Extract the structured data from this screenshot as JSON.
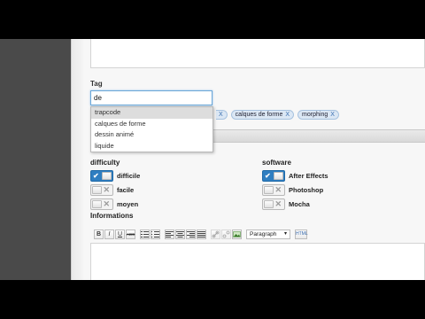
{
  "tag": {
    "label": "Tag",
    "input_value": "de",
    "suggestions": [
      "trapcode",
      "calques de forme",
      "dessin animé",
      "liquide"
    ],
    "chips": [
      {
        "label": "",
        "remove": "X"
      },
      {
        "label": "calques de forme",
        "remove": "X"
      },
      {
        "label": "morphing",
        "remove": "X"
      }
    ]
  },
  "difficulty": {
    "label": "difficulty",
    "options": [
      {
        "label": "difficile",
        "checked": true
      },
      {
        "label": "facile",
        "checked": false
      },
      {
        "label": "moyen",
        "checked": false
      }
    ]
  },
  "software": {
    "label": "software",
    "options": [
      {
        "label": "After Effects",
        "checked": true
      },
      {
        "label": "Photoshop",
        "checked": false
      },
      {
        "label": "Mocha",
        "checked": false
      }
    ]
  },
  "informations": {
    "label": "Informations",
    "toolbar": {
      "bold": "B",
      "italic": "I",
      "underline": "U",
      "strike": "ABC",
      "format_value": "Paragraph",
      "html": "HTML"
    }
  },
  "icons": {
    "check": "✔",
    "off": "✕",
    "dropdown": "▾"
  },
  "colors": {
    "accent": "#2f7ec1",
    "chip_bg": "#dbe7f4",
    "input_focus": "#6aa6d8"
  }
}
